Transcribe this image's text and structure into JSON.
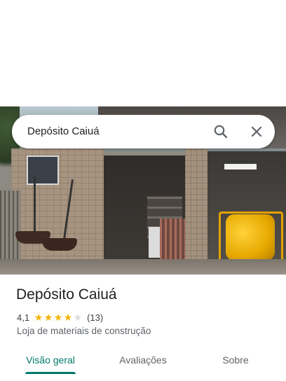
{
  "search": {
    "query": "Depósito Caiuá",
    "search_icon": "search-icon",
    "close_icon": "close-icon"
  },
  "place": {
    "title": "Depósito Caiuá",
    "rating": "4,1",
    "rating_value": 4.1,
    "stars_filled": 4,
    "stars_total": 5,
    "reviews_count": "(13)",
    "category": "Loja de materiais de construção"
  },
  "tabs": [
    {
      "label": "Visão geral",
      "active": true
    },
    {
      "label": "Avaliações",
      "active": false
    },
    {
      "label": "Sobre",
      "active": false
    }
  ],
  "colors": {
    "accent": "#00796b",
    "star": "#f4b400"
  }
}
